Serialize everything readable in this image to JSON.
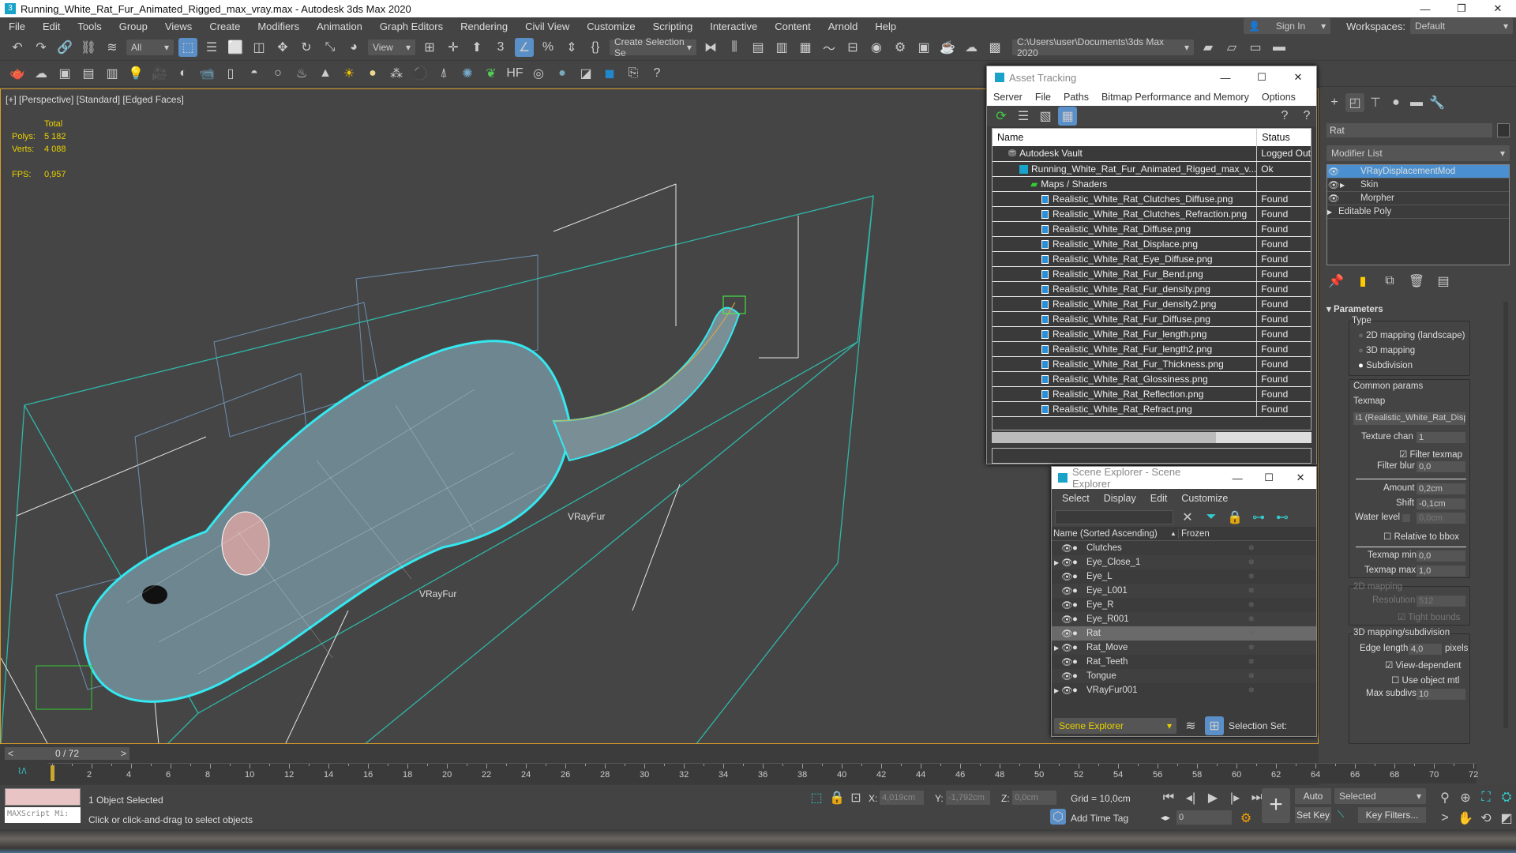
{
  "title": "Running_White_Rat_Fur_Animated_Rigged_max_vray.max - Autodesk 3ds Max 2020",
  "menu": [
    "File",
    "Edit",
    "Tools",
    "Group",
    "Views",
    "Create",
    "Modifiers",
    "Animation",
    "Graph Editors",
    "Rendering",
    "Civil View",
    "Customize",
    "Scripting",
    "Interactive",
    "Content",
    "Arnold",
    "Help"
  ],
  "sign_in": "Sign In",
  "workspaces_label": "Workspaces:",
  "workspace": "Default",
  "toolbar": {
    "filter": "All",
    "ref_coord": "View",
    "selection_set": "Create Selection Se",
    "project_path": "C:\\Users\\user\\Documents\\3ds Max 2020"
  },
  "viewport": {
    "label": "[+] [Perspective] [Standard] [Edged Faces]",
    "total": "Total",
    "polys_label": "Polys:",
    "polys": "5 182",
    "verts_label": "Verts:",
    "verts": "4 088",
    "fps_label": "FPS:",
    "fps": "0,957",
    "fur_label1": "VRayFur",
    "fur_label2": "VRayFur"
  },
  "asset_tracking": {
    "title": "Asset Tracking",
    "menu": [
      "Server",
      "File",
      "Paths",
      "Bitmap Performance and Memory",
      "Options"
    ],
    "col_name": "Name",
    "col_status": "Status",
    "rows": [
      {
        "name": "Autodesk Vault",
        "status": "Logged Out ...",
        "level": 0
      },
      {
        "name": "Running_White_Rat_Fur_Animated_Rigged_max_v...",
        "status": "Ok",
        "level": 1
      },
      {
        "name": "Maps / Shaders",
        "status": "",
        "level": 2
      },
      {
        "name": "Realistic_White_Rat_Clutches_Diffuse.png",
        "status": "Found",
        "level": 3
      },
      {
        "name": "Realistic_White_Rat_Clutches_Refraction.png",
        "status": "Found",
        "level": 3
      },
      {
        "name": "Realistic_White_Rat_Diffuse.png",
        "status": "Found",
        "level": 3
      },
      {
        "name": "Realistic_White_Rat_Displace.png",
        "status": "Found",
        "level": 3
      },
      {
        "name": "Realistic_White_Rat_Eye_Diffuse.png",
        "status": "Found",
        "level": 3
      },
      {
        "name": "Realistic_White_Rat_Fur_Bend.png",
        "status": "Found",
        "level": 3
      },
      {
        "name": "Realistic_White_Rat_Fur_density.png",
        "status": "Found",
        "level": 3
      },
      {
        "name": "Realistic_White_Rat_Fur_density2.png",
        "status": "Found",
        "level": 3
      },
      {
        "name": "Realistic_White_Rat_Fur_Diffuse.png",
        "status": "Found",
        "level": 3
      },
      {
        "name": "Realistic_White_Rat_Fur_length.png",
        "status": "Found",
        "level": 3
      },
      {
        "name": "Realistic_White_Rat_Fur_length2.png",
        "status": "Found",
        "level": 3
      },
      {
        "name": "Realistic_White_Rat_Fur_Thickness.png",
        "status": "Found",
        "level": 3
      },
      {
        "name": "Realistic_White_Rat_Glossiness.png",
        "status": "Found",
        "level": 3
      },
      {
        "name": "Realistic_White_Rat_Reflection.png",
        "status": "Found",
        "level": 3
      },
      {
        "name": "Realistic_White_Rat_Refract.png",
        "status": "Found",
        "level": 3
      }
    ]
  },
  "scene_explorer": {
    "title": "Scene Explorer - Scene Explorer",
    "menu": [
      "Select",
      "Display",
      "Edit",
      "Customize"
    ],
    "col_name": "Name (Sorted Ascending)",
    "col_frozen": "Frozen",
    "rows": [
      {
        "name": "Clutches",
        "expand": false
      },
      {
        "name": "Eye_Close_1",
        "expand": true
      },
      {
        "name": "Eye_L",
        "expand": false
      },
      {
        "name": "Eye_L001",
        "expand": false
      },
      {
        "name": "Eye_R",
        "expand": false
      },
      {
        "name": "Eye_R001",
        "expand": false
      },
      {
        "name": "Rat",
        "expand": false,
        "selected": true
      },
      {
        "name": "Rat_Move",
        "expand": true
      },
      {
        "name": "Rat_Teeth",
        "expand": false
      },
      {
        "name": "Tongue",
        "expand": false
      },
      {
        "name": "VRayFur001",
        "expand": true
      }
    ],
    "footer_dropdown": "Scene Explorer",
    "selection_set_label": "Selection Set:"
  },
  "command_panel": {
    "object_name": "Rat",
    "modifier_list": "Modifier List",
    "stack": [
      {
        "name": "VRayDisplacementMod",
        "selected": true
      },
      {
        "name": "Skin"
      },
      {
        "name": "Morpher"
      },
      {
        "name": "Editable Poly"
      }
    ],
    "rollout": "Parameters",
    "type_label": "Type",
    "types": [
      "2D mapping (landscape)",
      "3D mapping",
      "Subdivision"
    ],
    "type_selected": 2,
    "common": "Common params",
    "texmap_label": "Texmap",
    "texmap": "i1 (Realistic_White_Rat_Displa",
    "texture_chan_label": "Texture chan",
    "texture_chan": "1",
    "filter_texmap": "Filter texmap",
    "filter_blur_label": "Filter blur",
    "filter_blur": "0,0",
    "amount_label": "Amount",
    "amount": "0,2cm",
    "shift_label": "Shift",
    "shift": "-0,1cm",
    "water_label": "Water level",
    "water": "0,0cm",
    "relative": "Relative to bbox",
    "tmin_label": "Texmap min",
    "tmin": "0,0",
    "tmax_label": "Texmap max",
    "tmax": "1,0",
    "map2d": "2D mapping",
    "resolution_label": "Resolution",
    "resolution": "512",
    "tight": "Tight bounds",
    "map3d": "3D mapping/subdivision",
    "edge_label": "Edge length",
    "edge": "4,0",
    "pixels": "pixels",
    "viewdep": "View-dependent",
    "useobj": "Use object mtl",
    "maxsub_label": "Max subdivs",
    "maxsub": "10"
  },
  "timeline": {
    "frame_display": "0 / 72",
    "start": 0,
    "end": 72,
    "current": 0
  },
  "status": {
    "selected": "1 Object Selected",
    "prompt": "Click or click-and-drag to select objects",
    "maxscript": "MAXScript Mi:",
    "x_label": "X:",
    "x": "4,019cm",
    "y_label": "Y:",
    "y": "-1,792cm",
    "z_label": "Z:",
    "z": "0,0cm",
    "grid": "Grid = 10,0cm",
    "add_time_tag": "Add Time Tag",
    "auto_key": "Auto Key",
    "set_key": "Set Key",
    "key_mode": "Selected",
    "key_filters": "Key Filters...",
    "frame": "0"
  }
}
